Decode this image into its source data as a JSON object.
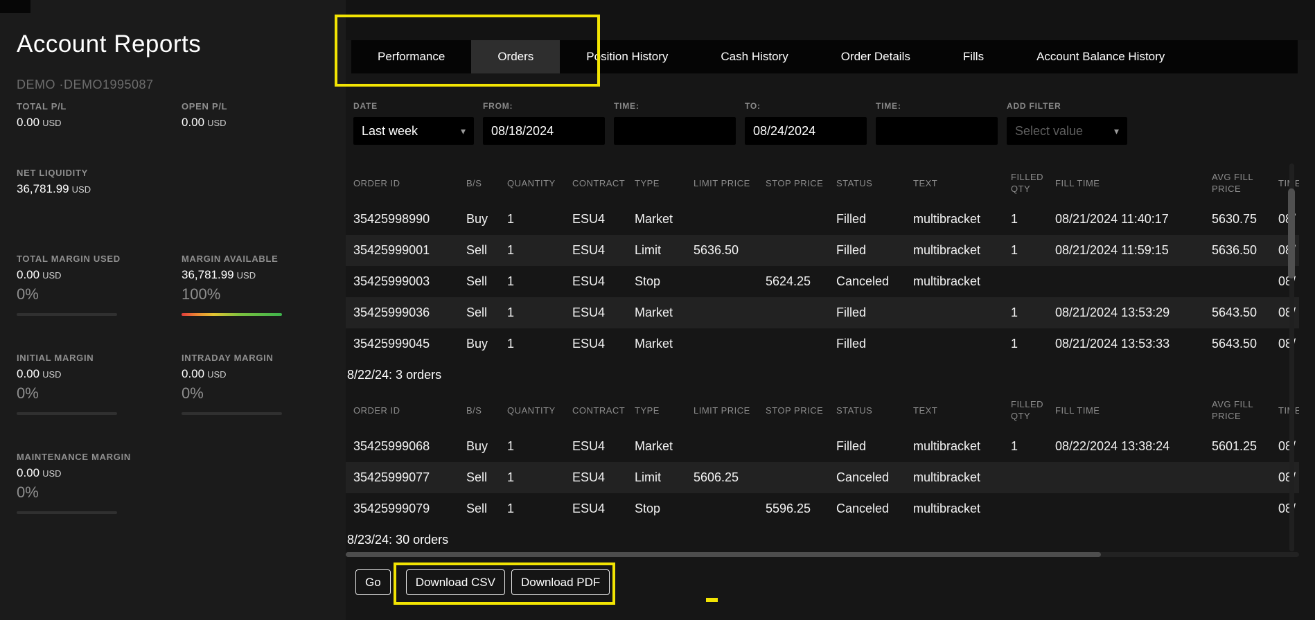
{
  "sidebar": {
    "title": "Account Reports",
    "subtitle": "DEMO ·DEMO1995087",
    "stats": [
      {
        "id": "total-pl",
        "label": "TOTAL P/L",
        "value": "0.00",
        "unit": "USD"
      },
      {
        "id": "open-pl",
        "label": "OPEN P/L",
        "value": "0.00",
        "unit": "USD"
      },
      {
        "id": "net-liquidity",
        "label": "NET LIQUIDITY",
        "value": "36,781.99",
        "unit": "USD"
      },
      {
        "id": "total-margin-used",
        "label": "TOTAL MARGIN USED",
        "value": "0.00",
        "unit": "USD",
        "percent": "0%",
        "bar_percent": 0
      },
      {
        "id": "margin-available",
        "label": "MARGIN AVAILABLE",
        "value": "36,781.99",
        "unit": "USD",
        "percent": "100%",
        "bar_percent": 100
      },
      {
        "id": "initial-margin",
        "label": "INITIAL MARGIN",
        "value": "0.00",
        "unit": "USD",
        "percent": "0%",
        "bar_percent": 0
      },
      {
        "id": "intraday-margin",
        "label": "INTRADAY MARGIN",
        "value": "0.00",
        "unit": "USD",
        "percent": "0%",
        "bar_percent": 0
      },
      {
        "id": "maintenance-margin",
        "label": "MAINTENANCE MARGIN",
        "value": "0.00",
        "unit": "USD",
        "percent": "0%",
        "bar_percent": 0
      }
    ]
  },
  "tabs": [
    {
      "id": "performance",
      "label": "Performance",
      "active": false
    },
    {
      "id": "orders",
      "label": "Orders",
      "active": true
    },
    {
      "id": "position-history",
      "label": "Position History",
      "active": false
    },
    {
      "id": "cash-history",
      "label": "Cash History",
      "active": false
    },
    {
      "id": "order-details",
      "label": "Order Details",
      "active": false
    },
    {
      "id": "fills",
      "label": "Fills",
      "active": false
    },
    {
      "id": "account-balance-history",
      "label": "Account Balance History",
      "active": false
    }
  ],
  "filters": {
    "date": {
      "label": "DATE",
      "value": "Last week"
    },
    "from": {
      "label": "FROM:",
      "value": "08/18/2024"
    },
    "time_from": {
      "label": "TIME:",
      "value": ""
    },
    "to": {
      "label": "TO:",
      "value": "08/24/2024"
    },
    "time_to": {
      "label": "TIME:",
      "value": ""
    },
    "add_filter": {
      "label": "ADD FILTER",
      "placeholder": "Select value"
    }
  },
  "orders_table": {
    "columns": [
      "ORDER ID",
      "B/S",
      "QUANTITY",
      "CONTRACT",
      "TYPE",
      "LIMIT PRICE",
      "STOP PRICE",
      "STATUS",
      "TEXT",
      "FILLED QTY",
      "FILL TIME",
      "AVG FILL PRICE",
      "TIME"
    ],
    "groups": [
      {
        "heading": "",
        "rows": [
          [
            "35425998990",
            "Buy",
            "1",
            "ESU4",
            "Market",
            "",
            "",
            "Filled",
            "multibracket",
            "1",
            "08/21/2024 11:40:17",
            "5630.75",
            "08/"
          ],
          [
            "35425999001",
            "Sell",
            "1",
            "ESU4",
            "Limit",
            "5636.50",
            "",
            "Filled",
            "multibracket",
            "1",
            "08/21/2024 11:59:15",
            "5636.50",
            "08/"
          ],
          [
            "35425999003",
            "Sell",
            "1",
            "ESU4",
            "Stop",
            "",
            "5624.25",
            "Canceled",
            "multibracket",
            "",
            "",
            "",
            "08/"
          ],
          [
            "35425999036",
            "Sell",
            "1",
            "ESU4",
            "Market",
            "",
            "",
            "Filled",
            "",
            "1",
            "08/21/2024 13:53:29",
            "5643.50",
            "08/"
          ],
          [
            "35425999045",
            "Buy",
            "1",
            "ESU4",
            "Market",
            "",
            "",
            "Filled",
            "",
            "1",
            "08/21/2024 13:53:33",
            "5643.50",
            "08/"
          ]
        ]
      },
      {
        "heading": "8/22/24: 3 orders",
        "rows": [
          [
            "35425999068",
            "Buy",
            "1",
            "ESU4",
            "Market",
            "",
            "",
            "Filled",
            "multibracket",
            "1",
            "08/22/2024 13:38:24",
            "5601.25",
            "08/"
          ],
          [
            "35425999077",
            "Sell",
            "1",
            "ESU4",
            "Limit",
            "5606.25",
            "",
            "Canceled",
            "multibracket",
            "",
            "",
            "",
            "08/"
          ],
          [
            "35425999079",
            "Sell",
            "1",
            "ESU4",
            "Stop",
            "",
            "5596.25",
            "Canceled",
            "multibracket",
            "",
            "",
            "",
            "08/"
          ]
        ]
      },
      {
        "heading": "8/23/24: 30 orders",
        "rows": []
      }
    ]
  },
  "buttons": {
    "go": "Go",
    "download_csv": "Download CSV",
    "download_pdf": "Download PDF"
  },
  "icons": {
    "chevron_down": "▾"
  },
  "annotations": {
    "highlight_color": "#f2e403",
    "items": [
      "tabs-highlight-box",
      "download-buttons-highlight-box",
      "dash-marker"
    ]
  }
}
